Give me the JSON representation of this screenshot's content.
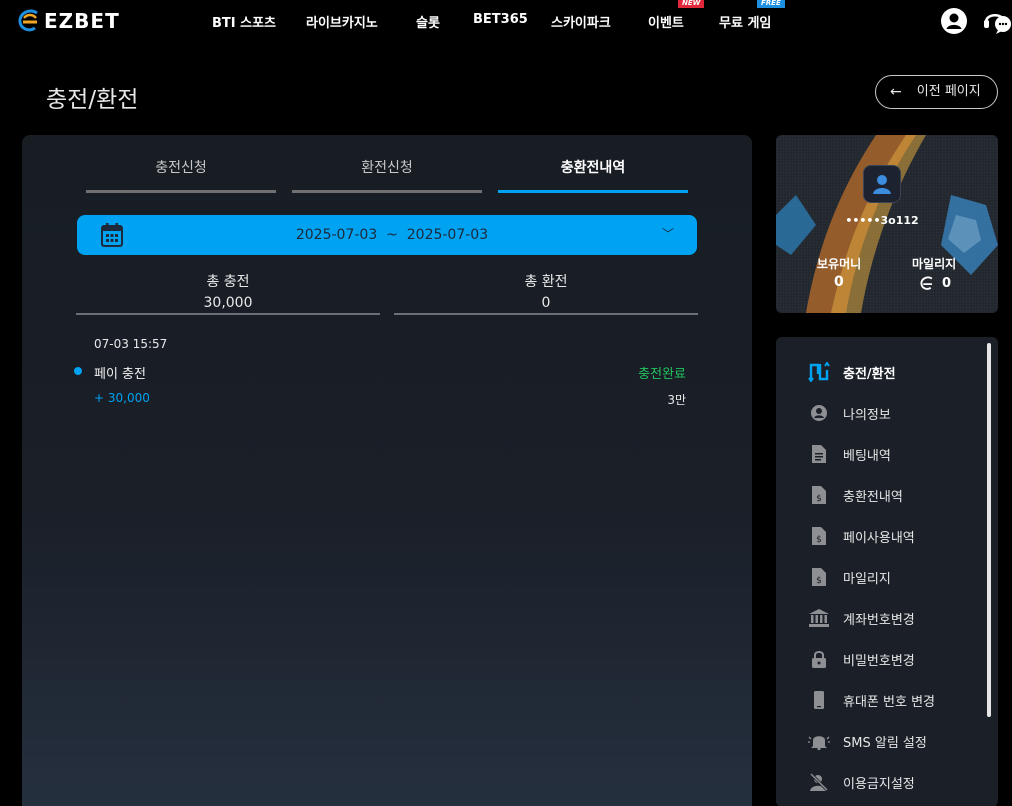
{
  "header": {
    "logo_text": "EZBET",
    "nav": [
      {
        "label": "BTI 스포츠"
      },
      {
        "label": "라이브카지노"
      },
      {
        "label": "슬롯"
      },
      {
        "label": "BET365"
      },
      {
        "label": "스카이파크"
      },
      {
        "label": "이벤트",
        "badge": "NEW"
      },
      {
        "label": "무료 게임",
        "badge": "FREE"
      }
    ],
    "icons": [
      "account-icon",
      "support-chat-icon"
    ]
  },
  "page": {
    "title": "충전/환전",
    "back_label": "이전 페이지"
  },
  "tabs": [
    {
      "label": "충전신청",
      "active": false
    },
    {
      "label": "환전신청",
      "active": false
    },
    {
      "label": "충환전내역",
      "active": true
    }
  ],
  "date_range": {
    "from": "2025-07-03",
    "separator": "~",
    "to": "2025-07-03",
    "text": "2025-07-03  ~  2025-07-03"
  },
  "summary": {
    "total_charge_label": "총 충전",
    "total_charge_value": "30,000",
    "total_exchange_label": "총 환전",
    "total_exchange_value": "0"
  },
  "transactions": [
    {
      "datetime": "07-03 15:57",
      "type": "페이 충전",
      "status": "충전완료",
      "amount": "+ 30,000",
      "short_amount": "3만"
    }
  ],
  "profile": {
    "username": "•••••3o112",
    "balance_label": "보유머니",
    "balance_value": "0",
    "mileage_label": "마일리지",
    "mileage_value": "0"
  },
  "menu": [
    {
      "label": "충전/환전",
      "icon": "exchange-icon",
      "active": true
    },
    {
      "label": "나의정보",
      "icon": "user-circle-icon",
      "active": false
    },
    {
      "label": "베팅내역",
      "icon": "document-icon",
      "active": false
    },
    {
      "label": "충환전내역",
      "icon": "money-document-icon",
      "active": false
    },
    {
      "label": "페이사용내역",
      "icon": "money-document-icon",
      "active": false
    },
    {
      "label": "마일리지",
      "icon": "money-document-icon",
      "active": false
    },
    {
      "label": "계좌번호변경",
      "icon": "bank-icon",
      "active": false
    },
    {
      "label": "비밀번호변경",
      "icon": "lock-icon",
      "active": false
    },
    {
      "label": "휴대폰 번호 변경",
      "icon": "phone-icon",
      "active": false
    },
    {
      "label": "SMS 알림 설정",
      "icon": "bell-icon",
      "active": false
    },
    {
      "label": "이용금지설정",
      "icon": "user-blocked-icon",
      "active": false
    }
  ],
  "colors": {
    "accent": "#00a2f2",
    "success": "#22c35e",
    "badge_new": "#e0283a",
    "badge_free": "#1d8fe0",
    "panel": "#1a1f28"
  }
}
